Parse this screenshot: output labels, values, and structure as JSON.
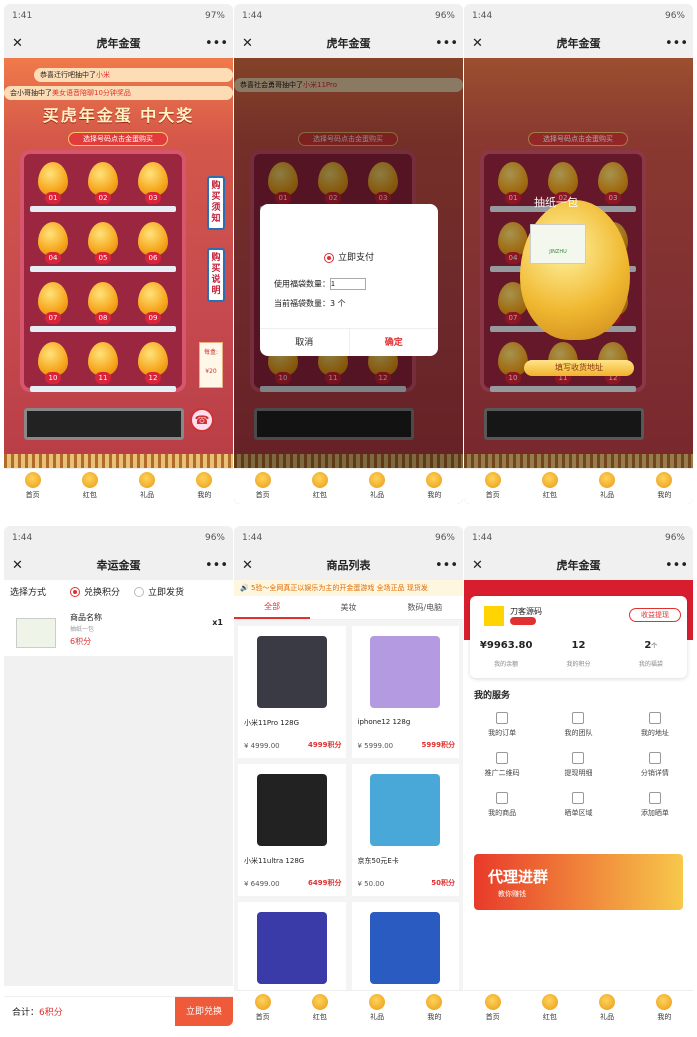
{
  "status": {
    "t1": "1:41",
    "t2": "1:44",
    "net1": "97%",
    "net2": "96%"
  },
  "game": {
    "title": "虎年金蛋",
    "marquee1": "恭喜迁行吧抽中了",
    "marquee1b": "小米",
    "marquee2": "恭喜社会勇哥抽中了",
    "marquee2b": "小米11Pro",
    "marquee3": "会小哥抽中了",
    "marquee3b": "美女语音陪聊10分钟奖品",
    "headline": "买虎年金蛋 中大奖",
    "pick_label": "选择号码点击金蛋购买",
    "eggs": [
      "01",
      "02",
      "03",
      "04",
      "05",
      "06",
      "07",
      "08",
      "09",
      "10",
      "11",
      "12"
    ],
    "side1": "购买须知",
    "side2": "购买说明",
    "price_label": "每盒:",
    "price_value": "¥20",
    "modal": {
      "pay": "立即支付",
      "use_label": "使用福袋数量：",
      "use_value": "1",
      "current": "当前福袋数量：3 个",
      "cancel": "取消",
      "ok": "确定"
    },
    "prize": {
      "title": "抽纸一包",
      "addr_btn": "填写收货地址",
      "brand": "JINZHU"
    }
  },
  "nav": [
    "首页",
    "红包",
    "礼品",
    "我的"
  ],
  "lucky": {
    "title": "幸运金蛋",
    "method_label": "选择方式",
    "opt1": "兑换积分",
    "opt2": "立即发货",
    "prod_name": "商品名称",
    "prod_sub": "抽纸一包",
    "prod_pts": "6积分",
    "qty": "x1",
    "total_label": "合计：",
    "total_val": "6积分",
    "btn": "立即兑换"
  },
  "products": {
    "title": "商品列表",
    "notice": "🔊 5验～全网真正以娱乐为主的开金蛋游戏 全场正品 现货发",
    "tabs": [
      "全部",
      "美妆",
      "数码/电脑"
    ],
    "items": [
      {
        "name": "小米11Pro 128G",
        "price": "¥ 4999.00",
        "pts": "4999积分",
        "color": "#3a3a44"
      },
      {
        "name": "iphone12 128g",
        "price": "¥ 5999.00",
        "pts": "5999积分",
        "color": "#b49ae0"
      },
      {
        "name": "小米11ultra 128G",
        "price": "¥ 6499.00",
        "pts": "6499积分",
        "color": "#222"
      },
      {
        "name": "京东50元E卡",
        "price": "¥ 50.00",
        "pts": "50积分",
        "color": "#4aa8d8"
      },
      {
        "name": "",
        "price": "",
        "pts": "",
        "color": "#3a3aa8"
      },
      {
        "name": "",
        "price": "",
        "pts": "",
        "color": "#2a5bc0"
      }
    ]
  },
  "mine": {
    "title": "虎年金蛋",
    "user": "刀客源码",
    "withdraw": "收益提现",
    "balance": "¥9963.80",
    "balance_lbl": "我的余额",
    "points": "12",
    "points_lbl": "我的积分",
    "bags": "2",
    "bags_unit": "个",
    "bags_lbl": "我的福袋",
    "service_title": "我的服务",
    "services": [
      "我的订单",
      "我的团队",
      "我的地址",
      "推广二维码",
      "提现明细",
      "分销详情",
      "我的商品",
      "晒单区域",
      "添加晒单"
    ],
    "banner": "代理进群",
    "banner_sub": "教你赚钱"
  }
}
